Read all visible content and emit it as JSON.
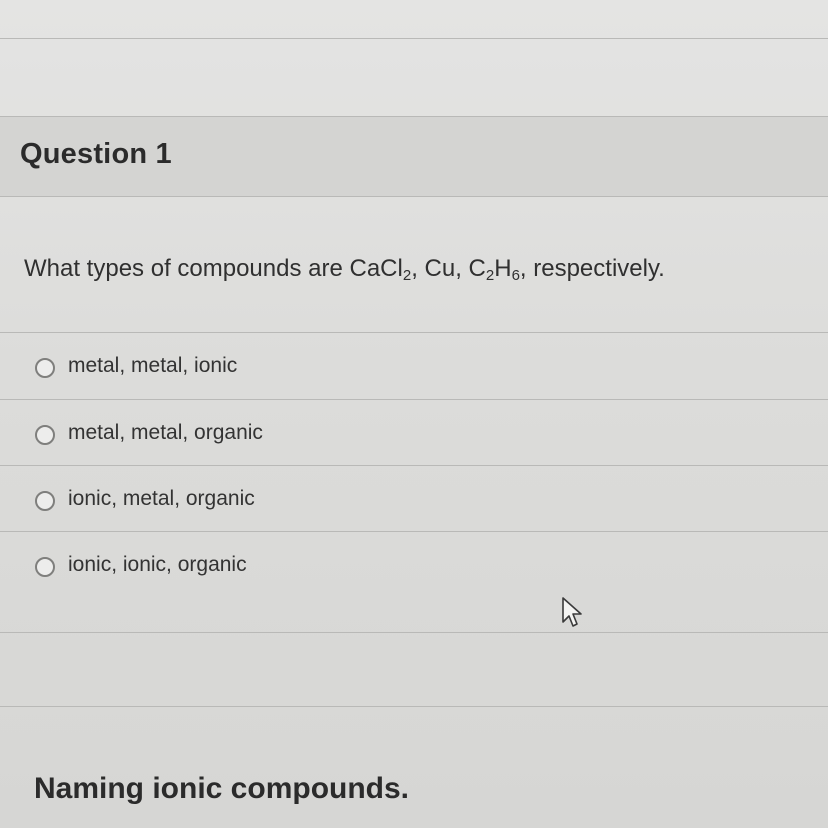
{
  "question": {
    "title": "Question 1",
    "prompt_before": "What types of compounds are CaCl",
    "sub_cacl": "2",
    "prompt_mid1": ", Cu, C",
    "sub_c": "2",
    "prompt_mid2": "H",
    "sub_h": "6",
    "prompt_after": ", respectively."
  },
  "options": [
    {
      "label": "metal, metal, ionic"
    },
    {
      "label": "metal, metal, organic"
    },
    {
      "label": "ionic, metal, organic"
    },
    {
      "label": "ionic, ionic, organic"
    }
  ],
  "next_section": {
    "title": "Naming ionic compounds."
  }
}
